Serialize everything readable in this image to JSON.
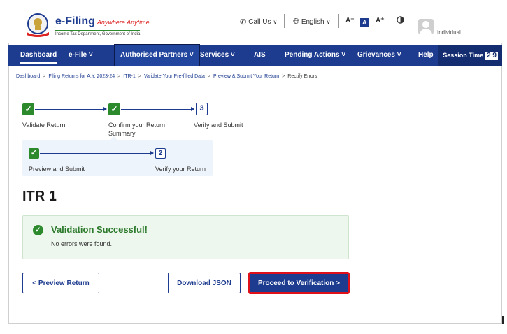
{
  "header": {
    "logo_title": "e-Filing",
    "logo_tagline": "Anywhere Anytime",
    "logo_subtitle": "Income Tax Department, Government of India",
    "call_us": "Call Us",
    "language": "English",
    "font_decrease": "A⁻",
    "font_normal": "A",
    "font_increase": "A⁺",
    "contrast_icon": "contrast-icon",
    "user_role": "Individual"
  },
  "nav": {
    "items": [
      {
        "label": "Dashboard"
      },
      {
        "label": "e-File ˅"
      },
      {
        "label": "Authorised Partners ˅"
      },
      {
        "label": "Services ˅"
      },
      {
        "label": "AIS"
      },
      {
        "label": "Pending Actions ˅"
      },
      {
        "label": "Grievances ˅"
      },
      {
        "label": "Help"
      }
    ],
    "session_label": "Session Time",
    "session_value": "2 9"
  },
  "breadcrumb": {
    "items": [
      "Dashboard",
      "Filing Returns for A.Y. 2023-24",
      "ITR-1",
      "Validate Your Pre-filled Data",
      "Preview & Submit Your Return"
    ],
    "current": "Rectify Errors",
    "separator": ">"
  },
  "stepper": {
    "steps": [
      {
        "label": "Validate Return",
        "state": "done"
      },
      {
        "label": "Confirm your Return Summary",
        "state": "done"
      },
      {
        "label": "Verify and Submit",
        "state": "active",
        "number": "3"
      }
    ],
    "sub_steps": [
      {
        "label": "Preview and Submit",
        "state": "done"
      },
      {
        "label": "Verify your Return",
        "state": "active",
        "number": "2"
      }
    ],
    "check_mark": "✓"
  },
  "main": {
    "title": "ITR 1",
    "status": {
      "title": "Validation Successful!",
      "message": "No errors were found."
    },
    "buttons": {
      "preview": "< Preview Return",
      "download": "Download JSON",
      "proceed": "Proceed to Verification >"
    }
  },
  "colors": {
    "brand": "#1d3b8f",
    "success": "#2c8a2c",
    "highlight": "#e0101a"
  }
}
